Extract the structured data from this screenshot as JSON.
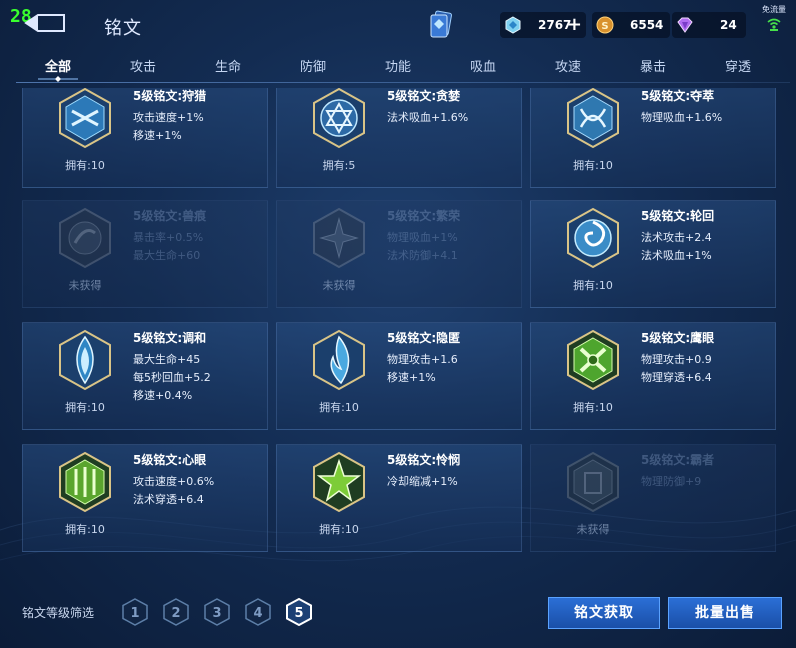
{
  "fps": "28",
  "header": {
    "title": "铭文"
  },
  "resources": {
    "diamond": "2767",
    "gold": "6554",
    "gem": "24"
  },
  "network": {
    "label": "免流量"
  },
  "tabs": [
    {
      "label": "全部",
      "active": true
    },
    {
      "label": "攻击"
    },
    {
      "label": "生命"
    },
    {
      "label": "防御"
    },
    {
      "label": "功能"
    },
    {
      "label": "吸血"
    },
    {
      "label": "攻速"
    },
    {
      "label": "暴击"
    },
    {
      "label": "穿透"
    }
  ],
  "cards": [
    {
      "name": "5级铭文:狩猎",
      "attrs": [
        "攻击速度+1%",
        "移速+1%"
      ],
      "owned": "拥有:10",
      "locked": false,
      "emblem_color": "#4fb6e8"
    },
    {
      "name": "5级铭文:贪婪",
      "attrs": [
        "法术吸血+1.6%"
      ],
      "owned": "拥有:5",
      "locked": false,
      "emblem_color": "#6ec3ee"
    },
    {
      "name": "5级铭文:夺萃",
      "attrs": [
        "物理吸血+1.6%"
      ],
      "owned": "拥有:10",
      "locked": false,
      "emblem_color": "#5fb4e4"
    },
    {
      "name": "5级铭文:兽痕",
      "attrs": [
        "暴击率+0.5%",
        "最大生命+60"
      ],
      "owned": "未获得",
      "locked": true,
      "emblem_color": "#5a7fa8"
    },
    {
      "name": "5级铭文:繁荣",
      "attrs": [
        "物理吸血+1%",
        "法术防御+4.1"
      ],
      "owned": "未获得",
      "locked": true,
      "emblem_color": "#5a7fa8"
    },
    {
      "name": "5级铭文:轮回",
      "attrs": [
        "法术攻击+2.4",
        "法术吸血+1%"
      ],
      "owned": "拥有:10",
      "locked": false,
      "emblem_color": "#7ccff2"
    },
    {
      "name": "5级铭文:调和",
      "attrs": [
        "最大生命+45",
        "每5秒回血+5.2",
        "移速+0.4%"
      ],
      "owned": "拥有:10",
      "locked": false,
      "emblem_color": "#8ad6f6"
    },
    {
      "name": "5级铭文:隐匿",
      "attrs": [
        "物理攻击+1.6",
        "移速+1%"
      ],
      "owned": "拥有:10",
      "locked": false,
      "emblem_color": "#7cc8f0"
    },
    {
      "name": "5级铭文:鹰眼",
      "attrs": [
        "物理攻击+0.9",
        "物理穿透+6.4"
      ],
      "owned": "拥有:10",
      "locked": false,
      "emblem_color": "#6fcf3a"
    },
    {
      "name": "5级铭文:心眼",
      "attrs": [
        "攻击速度+0.6%",
        "法术穿透+6.4"
      ],
      "owned": "拥有:10",
      "locked": false,
      "emblem_color": "#78c93a"
    },
    {
      "name": "5级铭文:怜悯",
      "attrs": [
        "冷却缩减+1%"
      ],
      "owned": "拥有:10",
      "locked": false,
      "emblem_color": "#86d63e"
    },
    {
      "name": "5级铭文:霸者",
      "attrs": [
        "物理防御+9"
      ],
      "owned": "未获得",
      "locked": true,
      "emblem_color": "#4f7f58"
    }
  ],
  "filter": {
    "label": "铭文等级筛选",
    "levels": [
      "1",
      "2",
      "3",
      "4",
      "5"
    ],
    "selected": "5"
  },
  "buttons": {
    "get": "铭文获取",
    "sell": "批量出售"
  }
}
